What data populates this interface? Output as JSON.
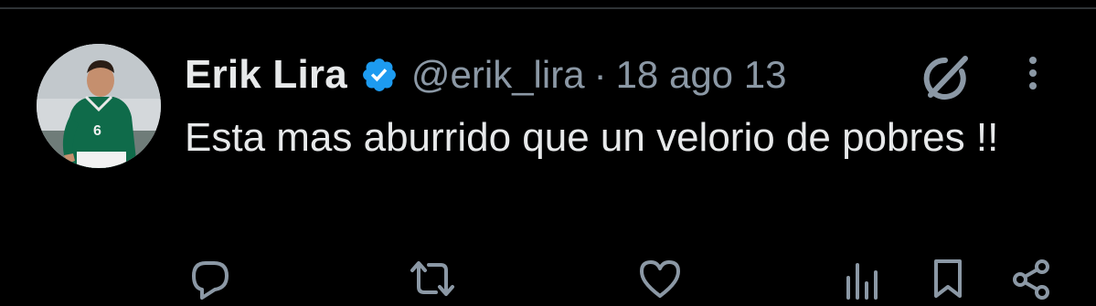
{
  "tweet": {
    "author": {
      "display_name": "Erik Lira",
      "handle": "@erik_lira",
      "verified": true,
      "avatar_jersey_number": "6"
    },
    "separator": "·",
    "date": "18 ago 13",
    "text": "Esta mas aburrido que un velorio de pobres !!"
  },
  "icons": {
    "verified": "verified-badge-icon",
    "grok": "grok-icon",
    "more": "more-options-icon",
    "reply": "reply-icon",
    "retweet": "retweet-icon",
    "like": "like-icon",
    "views": "views-icon",
    "bookmark": "bookmark-icon",
    "share": "share-icon"
  },
  "colors": {
    "background": "#000000",
    "text_primary": "#e7e9ea",
    "text_secondary": "#8b98a5",
    "verified_blue": "#1d9bf0",
    "divider": "#2f3336"
  }
}
